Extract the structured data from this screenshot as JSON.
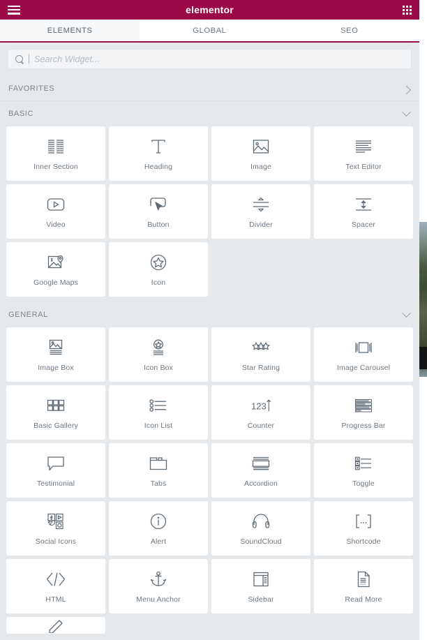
{
  "topbar": {
    "menu_icon": "hamburger-icon",
    "title": "elementor",
    "apps_icon": "apps-grid-icon"
  },
  "tabs": [
    {
      "label": "ELEMENTS",
      "active": true
    },
    {
      "label": "GLOBAL",
      "active": false
    },
    {
      "label": "SEO",
      "active": false
    }
  ],
  "search": {
    "value": "",
    "placeholder": "Search Widget..."
  },
  "sections": [
    {
      "id": "favorites",
      "label": "FAVORITES",
      "expanded": false,
      "chevron": "chevron-right-icon",
      "widgets": []
    },
    {
      "id": "basic",
      "label": "BASIC",
      "expanded": true,
      "chevron": "chevron-down-icon",
      "widgets": [
        {
          "label": "Inner Section",
          "icon": "inner-section-icon"
        },
        {
          "label": "Heading",
          "icon": "heading-icon"
        },
        {
          "label": "Image",
          "icon": "image-icon"
        },
        {
          "label": "Text Editor",
          "icon": "text-editor-icon"
        },
        {
          "label": "Video",
          "icon": "video-icon"
        },
        {
          "label": "Button",
          "icon": "button-icon"
        },
        {
          "label": "Divider",
          "icon": "divider-icon"
        },
        {
          "label": "Spacer",
          "icon": "spacer-icon"
        },
        {
          "label": "Google Maps",
          "icon": "google-maps-icon"
        },
        {
          "label": "Icon",
          "icon": "star-circle-icon"
        }
      ]
    },
    {
      "id": "general",
      "label": "GENERAL",
      "expanded": true,
      "chevron": "chevron-down-icon",
      "widgets": [
        {
          "label": "Image Box",
          "icon": "image-box-icon"
        },
        {
          "label": "Icon Box",
          "icon": "icon-box-icon"
        },
        {
          "label": "Star Rating",
          "icon": "star-rating-icon"
        },
        {
          "label": "Image Carousel",
          "icon": "image-carousel-icon"
        },
        {
          "label": "Basic Gallery",
          "icon": "basic-gallery-icon"
        },
        {
          "label": "Icon List",
          "icon": "icon-list-icon"
        },
        {
          "label": "Counter",
          "icon": "counter-icon"
        },
        {
          "label": "Progress Bar",
          "icon": "progress-bar-icon"
        },
        {
          "label": "Testimonial",
          "icon": "testimonial-icon"
        },
        {
          "label": "Tabs",
          "icon": "tabs-icon"
        },
        {
          "label": "Accordion",
          "icon": "accordion-icon"
        },
        {
          "label": "Toggle",
          "icon": "toggle-icon"
        },
        {
          "label": "Social Icons",
          "icon": "social-icons-icon"
        },
        {
          "label": "Alert",
          "icon": "alert-icon"
        },
        {
          "label": "SoundCloud",
          "icon": "soundcloud-icon"
        },
        {
          "label": "Shortcode",
          "icon": "shortcode-icon"
        },
        {
          "label": "HTML",
          "icon": "html-icon"
        },
        {
          "label": "Menu Anchor",
          "icon": "menu-anchor-icon"
        },
        {
          "label": "Sidebar",
          "icon": "sidebar-icon"
        },
        {
          "label": "Read More",
          "icon": "read-more-icon"
        }
      ]
    }
  ],
  "colors": {
    "brand": "#9b0a46",
    "panel_bg": "#e6e9ec",
    "card_bg": "#ffffff",
    "text": "#6d7882",
    "icon": "#5e6a75"
  }
}
